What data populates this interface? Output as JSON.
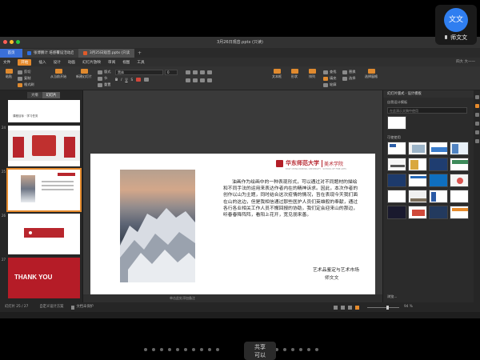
{
  "window": {
    "title": "3月26日观音.pptx (只读)"
  },
  "tabs": [
    {
      "label": "首页",
      "color": "#3a6fd8"
    },
    {
      "label": "张博鹏计 培感覆设活动启…",
      "color": "#2d6fe0"
    },
    {
      "label": "3月25日观音.pptx (只读)",
      "color": "#e05b2a"
    }
  ],
  "menubar": {
    "file_label": "文件",
    "items": [
      "开始",
      "插入",
      "设计",
      "动画",
      "幻灯片放映",
      "审阅",
      "视图",
      "工具"
    ],
    "active_index": 0,
    "right_text": "四大 大一一"
  },
  "ribbon": {
    "paste_label": "粘贴",
    "cut_label": "剪切",
    "copy_label": "复制",
    "format_label": "格式刷",
    "from_current_label": "从当前开始",
    "new_slide_label": "新建幻灯片",
    "layout_label": "版式",
    "section_label": "节",
    "reset_label": "重置",
    "font_value": "黑体",
    "size_value": "0",
    "textbox_label": "文本框",
    "shape_label": "形状",
    "arrange_label": "排列",
    "find_label": "查找",
    "replace_label": "替换",
    "select_label": "选择",
    "fill_label": "填充",
    "outline_label": "轮廓",
    "style_label": "选择窗格"
  },
  "sidepanel": {
    "view_outline": "大纲",
    "view_slides": "幻灯片",
    "slides": [
      {
        "number": "24",
        "label": "课程目标 · 学习任务"
      },
      {
        "number": "25",
        "label": ""
      },
      {
        "number": "26",
        "label": ""
      },
      {
        "number": "27",
        "label": "THANK YOU"
      }
    ],
    "add_label": "+"
  },
  "slide": {
    "school_logo_text": "华东师范大学",
    "school_dept": "美术学院",
    "school_sub": "EAST CHINA NORMAL UNIVERSITY · SCHOOL OF FINE ARTS",
    "body": "油画作为绘画中的一种表现形式，可以通过对不同题材的描绘和不同手法的运用来表达作者内在的精神诉求。因此，本次作者的创作以山为主题，同时结合这次疫情的情况，旨在表现今天我们面在山的这边，但是我相信通过那些医护人员们英雄般的奉献，通过各行各业相关工作人员不懈回报的协助，我们定会迎来山的那边，听春春降阵阵，看阳上花开，宽见朋来善。",
    "course": "艺术品鉴定与艺术市场",
    "author": "师文文"
  },
  "notes_placeholder": "单击此处添加备注",
  "rightpane": {
    "header": "幻灯片版式 · 设计模板",
    "section1": "自我设计模板",
    "search_placeholder": "在此演示文稿中使用",
    "section2": "可使使用",
    "more_label": "浏览..."
  },
  "statusbar": {
    "slide_counter": "幻灯片 25 / 27",
    "theme_label": "自定义设计方案",
    "protect_label": "文档未保护",
    "zoom": "94 %"
  },
  "zoom_overlay": {
    "avatar_text": "文文",
    "user_name": "师文文"
  },
  "share_bar": {
    "line1": "共享",
    "line2": "可以"
  }
}
